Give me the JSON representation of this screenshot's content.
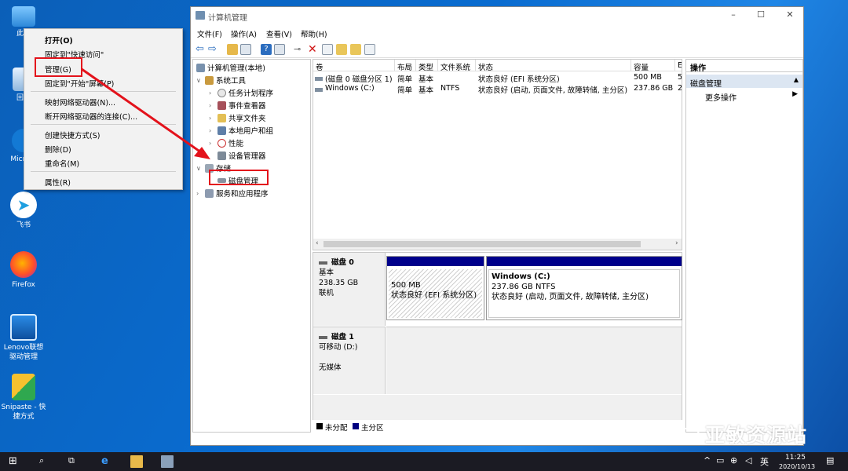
{
  "desktop": {
    "icons": [
      {
        "label": "此电",
        "icon": "pc-icon"
      },
      {
        "label": "回收",
        "icon": "recycle-bin-icon"
      },
      {
        "label": "Micr Ed",
        "icon": "edge-icon"
      },
      {
        "label": "飞书",
        "icon": "feishu-icon"
      },
      {
        "label": "Firefox",
        "icon": "firefox-icon"
      },
      {
        "label": "Lenovo联想 驱动管理",
        "icon": "lenovo-icon"
      },
      {
        "label": "Snipaste - 快捷方式",
        "icon": "snipaste-icon"
      }
    ]
  },
  "context_menu": {
    "items": [
      "打开(O)",
      "固定到\"快速访问\"",
      "管理(G)",
      "固定到\"开始\"屏幕(P)",
      "映射网络驱动器(N)...",
      "断开网络驱动器的连接(C)...",
      "创建快捷方式(S)",
      "删除(D)",
      "重命名(M)",
      "属性(R)"
    ]
  },
  "window": {
    "title": "计算机管理",
    "menu": [
      "文件(F)",
      "操作(A)",
      "查看(V)",
      "帮助(H)"
    ],
    "tree": {
      "root": "计算机管理(本地)",
      "system_tools": "系统工具",
      "task_scheduler": "任务计划程序",
      "event_viewer": "事件查看器",
      "shared_folders": "共享文件夹",
      "local_users": "本地用户和组",
      "performance": "性能",
      "device_manager": "设备管理器",
      "storage": "存储",
      "disk_management": "磁盘管理",
      "services_apps": "服务和应用程序"
    },
    "volume_list": {
      "columns": [
        "卷",
        "布局",
        "类型",
        "文件系统",
        "状态",
        "容量",
        "E"
      ],
      "rows": [
        [
          "(磁盘 0 磁盘分区 1)",
          "简单",
          "基本",
          "",
          "状态良好 (EFI 系统分区)",
          "500 MB",
          "5"
        ],
        [
          "Windows (C:)",
          "简单",
          "基本",
          "NTFS",
          "状态良好 (启动, 页面文件, 故障转储, 主分区)",
          "237.86 GB",
          "2"
        ]
      ]
    },
    "disks": [
      {
        "name": "磁盘 0",
        "type": "基本",
        "size": "238.35 GB",
        "status": "联机"
      },
      {
        "name": "磁盘 1",
        "type": "可移动 (D:)",
        "size": "",
        "status": "无媒体"
      }
    ],
    "partitions": [
      {
        "name": "",
        "size": "500 MB",
        "status": "状态良好 (EFI 系统分区)"
      },
      {
        "name": "Windows (C:)",
        "size": "237.86 GB NTFS",
        "status": "状态良好 (启动, 页面文件, 故障转储, 主分区)"
      }
    ],
    "legend": [
      "未分配",
      "主分区"
    ],
    "actions": {
      "header": "操作",
      "section": "磁盘管理",
      "more": "更多操作"
    }
  },
  "taskbar": {
    "time": "11:25",
    "date": "2020/10/13",
    "ime": "英"
  },
  "watermark": "亚敏资源站",
  "colors": {
    "accent": "#00007f",
    "highlight": "#e3121b",
    "partition_bar": "#00008b"
  }
}
